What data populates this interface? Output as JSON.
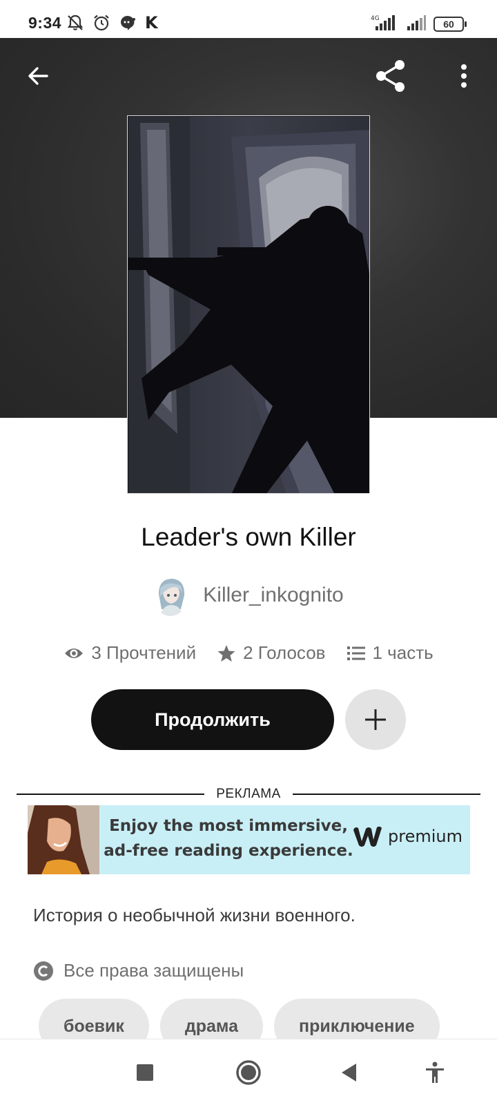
{
  "status_bar": {
    "time": "9:34",
    "left_icons": [
      "notifications-off-icon",
      "alarm-icon",
      "chat-bubble-icon",
      "k-app-icon"
    ],
    "k_glyph": "K",
    "network_label": "4G",
    "battery": "60"
  },
  "header": {
    "back_icon": "arrow-left-icon",
    "share_icon": "share-icon",
    "more_icon": "more-vertical-icon"
  },
  "story": {
    "title": "Leader's own Killer",
    "author": "Killer_inkognito",
    "stats": {
      "reads": "3 Прочтений",
      "votes": "2 Голосов",
      "parts": "1 часть"
    },
    "continue_label": "Продолжить",
    "description": "История о необычной жизни военного.",
    "copyright": "Все права защищены",
    "tags": [
      "боевик",
      "драма",
      "приключение"
    ]
  },
  "ad": {
    "label": "РЕКЛАМА",
    "line1": "Enjoy the most immersive,",
    "line2": "ad-free reading experience.",
    "brand": "premium"
  },
  "nav": {
    "icons": [
      "square-icon",
      "home-circle-icon",
      "back-triangle-icon",
      "accessibility-icon"
    ]
  },
  "colors": {
    "primary_button": "#121212",
    "secondary_button": "#e3e3e3",
    "ad_background": "#c9eff6",
    "muted_text": "#6f6f6f"
  }
}
